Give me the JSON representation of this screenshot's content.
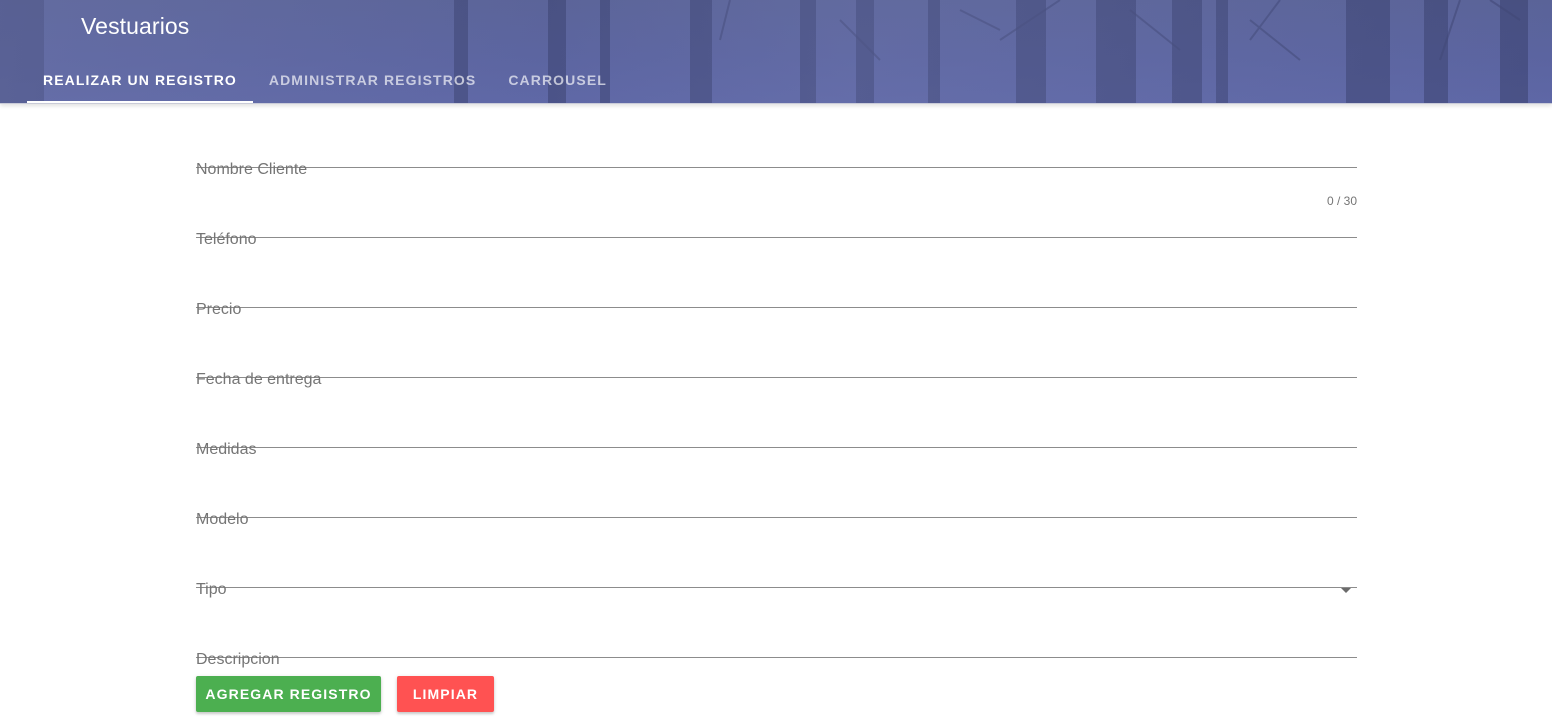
{
  "app": {
    "title": "Vestuarios"
  },
  "tabs": [
    {
      "label": "REALIZAR UN REGISTRO",
      "active": true
    },
    {
      "label": "ADMINISTRAR REGISTROS",
      "active": false
    },
    {
      "label": "CARROUSEL",
      "active": false
    }
  ],
  "form": {
    "fields": [
      {
        "label": "Nombre Cliente",
        "counter": "0 / 30"
      },
      {
        "label": "Teléfono"
      },
      {
        "label": "Precio"
      },
      {
        "label": "Fecha de entrega"
      },
      {
        "label": "Medidas"
      },
      {
        "label": "Modelo"
      },
      {
        "label": "Tipo",
        "type": "select"
      },
      {
        "label": "Descripcion"
      }
    ],
    "buttons": {
      "add_label": "AGREGAR REGISTRO",
      "clear_label": "LIMPIAR"
    }
  },
  "colors": {
    "header": "#5b64a0",
    "add_button": "#4caf50",
    "clear_button": "#ff5252"
  },
  "icons": {
    "select_caret": "caret-down-icon"
  }
}
